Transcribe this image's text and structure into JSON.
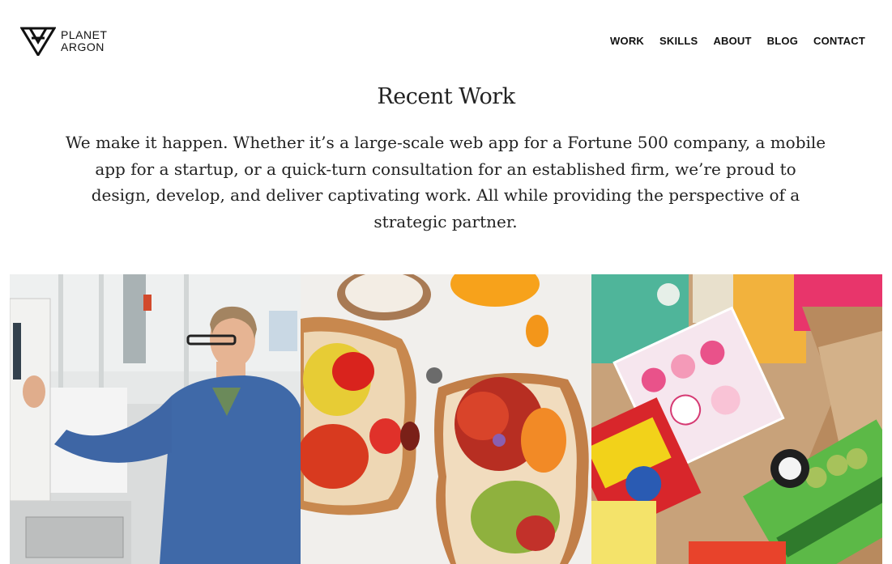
{
  "brand": {
    "line1": "PLANET",
    "line2": "ARGON"
  },
  "nav": {
    "items": [
      {
        "label": "WORK"
      },
      {
        "label": "SKILLS"
      },
      {
        "label": "ABOUT"
      },
      {
        "label": "BLOG"
      },
      {
        "label": "CONTACT"
      }
    ]
  },
  "main": {
    "title": "Recent Work",
    "intro": "We make it happen. Whether it’s a large-scale web app for a Fortune 500 company, a mobile app for a startup, or a quick-turn consultation for an established firm, we’re proud to design, develop, and deliver captivating work. All while providing the perspective of a strategic partner."
  },
  "gallery": {
    "tiles": [
      {
        "icon": "factory-worker-photo"
      },
      {
        "icon": "tomato-toast-photo"
      },
      {
        "icon": "japanese-snacks-photo"
      }
    ]
  },
  "colors": {
    "text": "#1a1a1a",
    "background": "#ffffff"
  }
}
